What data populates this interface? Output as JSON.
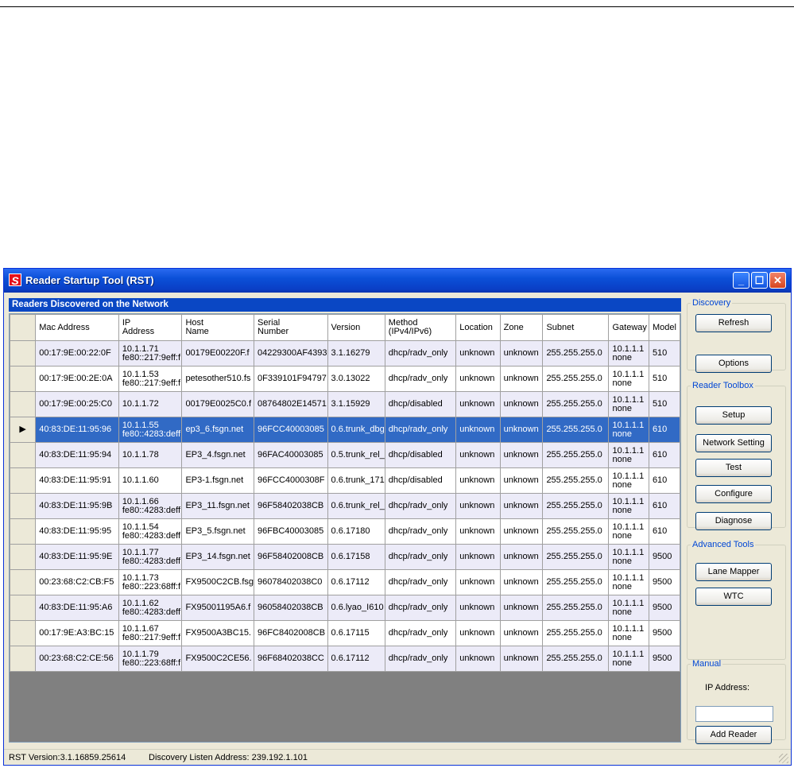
{
  "window": {
    "title": "Reader Startup Tool (RST)",
    "icon": "S"
  },
  "section_header": "Readers Discovered on the Network",
  "columns": [
    {
      "l1": "Mac Address",
      "l2": ""
    },
    {
      "l1": "IP",
      "l2": "Address"
    },
    {
      "l1": "Host",
      "l2": "Name"
    },
    {
      "l1": "Serial",
      "l2": "Number"
    },
    {
      "l1": "Version",
      "l2": ""
    },
    {
      "l1": "Method",
      "l2": "(IPv4/IPv6)"
    },
    {
      "l1": "Location",
      "l2": ""
    },
    {
      "l1": "Zone",
      "l2": ""
    },
    {
      "l1": "Subnet",
      "l2": ""
    },
    {
      "l1": "Gateway",
      "l2": ""
    },
    {
      "l1": "Model",
      "l2": ""
    }
  ],
  "rows": [
    {
      "mac": "00:17:9E:00:22:0F",
      "ip1": "10.1.1.71",
      "ip2": "fe80::217:9eff:f",
      "host": "00179E00220F.f",
      "serial": "04229300AF4393",
      "version": "3.1.16279",
      "method": "dhcp/radv_only",
      "location": "unknown",
      "zone": "unknown",
      "subnet": "255.255.255.0",
      "gw1": "10.1.1.1",
      "gw2": "none",
      "model": "510"
    },
    {
      "mac": "00:17:9E:00:2E:0A",
      "ip1": "10.1.1.53",
      "ip2": "fe80::217:9eff:f",
      "host": "petesother510.fs",
      "serial": "0F339101F94797",
      "version": "3.0.13022",
      "method": "dhcp/radv_only",
      "location": "unknown",
      "zone": "unknown",
      "subnet": "255.255.255.0",
      "gw1": "10.1.1.1",
      "gw2": "none",
      "model": "510"
    },
    {
      "mac": "00:17:9E:00:25:C0",
      "ip1": "10.1.1.72",
      "ip2": "",
      "host": "00179E0025C0.f",
      "serial": "08764802E14571",
      "version": "3.1.15929",
      "method": "dhcp/disabled",
      "location": "unknown",
      "zone": "unknown",
      "subnet": "255.255.255.0",
      "gw1": "10.1.1.1",
      "gw2": "none",
      "model": "510"
    },
    {
      "mac": "40:83:DE:11:95:96",
      "ip1": "10.1.1.55",
      "ip2": "fe80::4283:deff",
      "host": "ep3_6.fsgn.net",
      "serial": "96FCC40003085",
      "version": "0.6.trunk_dbg",
      "method": "dhcp/radv_only",
      "location": "unknown",
      "zone": "unknown",
      "subnet": "255.255.255.0",
      "gw1": "10.1.1.1",
      "gw2": "none",
      "model": "610"
    },
    {
      "mac": "40:83:DE:11:95:94",
      "ip1": "10.1.1.78",
      "ip2": "",
      "host": "EP3_4.fsgn.net",
      "serial": "96FAC40003085",
      "version": "0.5.trunk_rel_",
      "method": "dhcp/disabled",
      "location": "unknown",
      "zone": "unknown",
      "subnet": "255.255.255.0",
      "gw1": "10.1.1.1",
      "gw2": "none",
      "model": "610"
    },
    {
      "mac": "40:83:DE:11:95:91",
      "ip1": "10.1.1.60",
      "ip2": "",
      "host": "EP3-1.fsgn.net",
      "serial": "96FCC4000308F",
      "version": "0.6.trunk_171",
      "method": "dhcp/disabled",
      "location": "unknown",
      "zone": "unknown",
      "subnet": "255.255.255.0",
      "gw1": "10.1.1.1",
      "gw2": "none",
      "model": "610"
    },
    {
      "mac": "40:83:DE:11:95:9B",
      "ip1": "10.1.1.66",
      "ip2": "fe80::4283:deff",
      "host": "EP3_11.fsgn.net",
      "serial": "96F58402038CB",
      "version": "0.6.trunk_rel_",
      "method": "dhcp/radv_only",
      "location": "unknown",
      "zone": "unknown",
      "subnet": "255.255.255.0",
      "gw1": "10.1.1.1",
      "gw2": "none",
      "model": "610"
    },
    {
      "mac": "40:83:DE:11:95:95",
      "ip1": "10.1.1.54",
      "ip2": "fe80::4283:deff",
      "host": "EP3_5.fsgn.net",
      "serial": "96FBC40003085",
      "version": "0.6.17180",
      "method": "dhcp/radv_only",
      "location": "unknown",
      "zone": "unknown",
      "subnet": "255.255.255.0",
      "gw1": "10.1.1.1",
      "gw2": "none",
      "model": "610"
    },
    {
      "mac": "40:83:DE:11:95:9E",
      "ip1": "10.1.1.77",
      "ip2": "fe80::4283:deff",
      "host": "EP3_14.fsgn.net",
      "serial": "96F58402008CB",
      "version": "0.6.17158",
      "method": "dhcp/radv_only",
      "location": "unknown",
      "zone": "unknown",
      "subnet": "255.255.255.0",
      "gw1": "10.1.1.1",
      "gw2": "none",
      "model": "9500"
    },
    {
      "mac": "00:23:68:C2:CB:F5",
      "ip1": "10.1.1.73",
      "ip2": "fe80::223:68ff:f",
      "host": "FX9500C2CB.fsg",
      "serial": "96078402038C0",
      "version": "0.6.17112",
      "method": "dhcp/radv_only",
      "location": "unknown",
      "zone": "unknown",
      "subnet": "255.255.255.0",
      "gw1": "10.1.1.1",
      "gw2": "none",
      "model": "9500"
    },
    {
      "mac": "40:83:DE:11:95:A6",
      "ip1": "10.1.1.62",
      "ip2": "fe80::4283:deff",
      "host": "FX95001195A6.f",
      "serial": "96058402038CB",
      "version": "0.6.lyao_I610",
      "method": "dhcp/radv_only",
      "location": "unknown",
      "zone": "unknown",
      "subnet": "255.255.255.0",
      "gw1": "10.1.1.1",
      "gw2": "none",
      "model": "9500"
    },
    {
      "mac": "00:17:9E:A3:BC:15",
      "ip1": "10.1.1.67",
      "ip2": "fe80::217:9eff:f",
      "host": "FX9500A3BC15.",
      "serial": "96FC8402008CB",
      "version": "0.6.17115",
      "method": "dhcp/radv_only",
      "location": "unknown",
      "zone": "unknown",
      "subnet": "255.255.255.0",
      "gw1": "10.1.1.1",
      "gw2": "none",
      "model": "9500"
    },
    {
      "mac": "00:23:68:C2:CE:56",
      "ip1": "10.1.1.79",
      "ip2": "fe80::223:68ff:f",
      "host": "FX9500C2CE56.",
      "serial": "96F68402038CC",
      "version": "0.6.17112",
      "method": "dhcp/radv_only",
      "location": "unknown",
      "zone": "unknown",
      "subnet": "255.255.255.0",
      "gw1": "10.1.1.1",
      "gw2": "none",
      "model": "9500"
    }
  ],
  "selected_row_marker": "▶",
  "panel": {
    "discovery": {
      "legend": "Discovery",
      "refresh": "Refresh",
      "options": "Options"
    },
    "toolbox": {
      "legend": "Reader Toolbox",
      "setup": "Setup",
      "network_setting": "Network Setting",
      "test": "Test",
      "configure": "Configure",
      "diagnose": "Diagnose"
    },
    "advanced": {
      "legend": "Advanced Tools",
      "lane_mapper": "Lane Mapper",
      "wtc": "WTC"
    },
    "manual": {
      "legend": "Manual",
      "ip_label": "IP Address:",
      "ip_value": "",
      "add_reader": "Add Reader"
    }
  },
  "status": {
    "version": "RST Version:3.1.16859.25614",
    "listen": "Discovery Listen Address: 239.192.1.101"
  },
  "colors": {
    "title_blue": "#0b50d8",
    "selection": "#316ac5",
    "header_blue": "#0a47c4",
    "alt_row": "#ecebf8"
  }
}
